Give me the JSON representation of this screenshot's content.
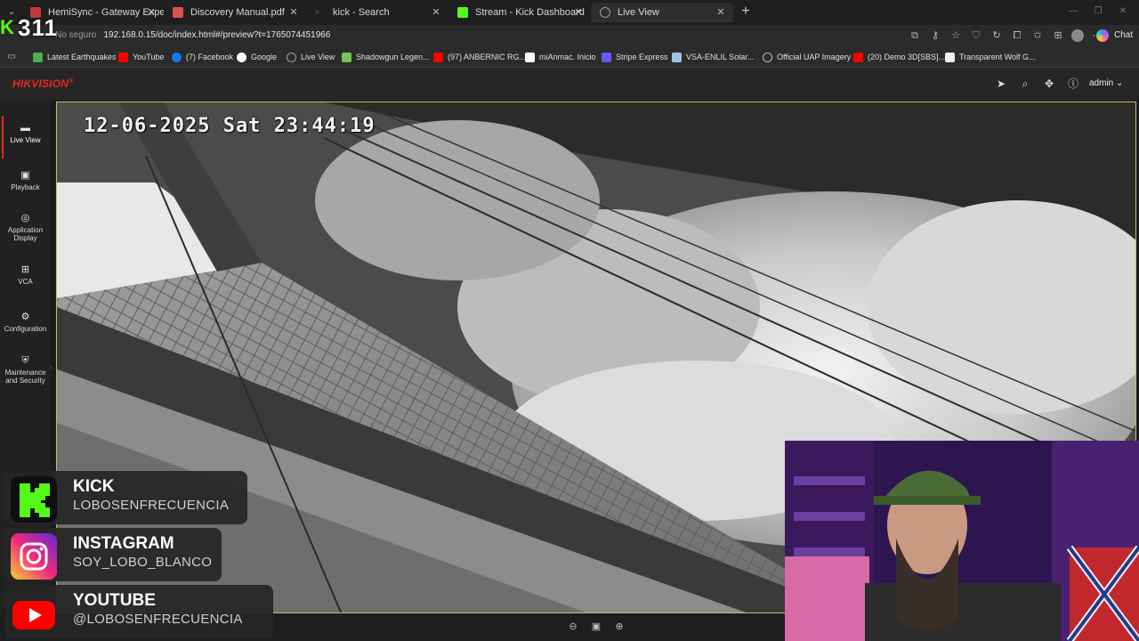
{
  "browser": {
    "tabs": [
      {
        "title": "HemiSync - Gateway Experience -",
        "favicon_color": "#c23b3b",
        "active": false
      },
      {
        "title": "Discovery Manual.pdf",
        "favicon_color": "#d9534f",
        "active": false
      },
      {
        "title": "kick - Search",
        "favicon_color": "#3c7be0",
        "active": false
      },
      {
        "title": "Stream - Kick Dashboard",
        "favicon_color": "#53fc18",
        "active": false
      },
      {
        "title": "Live View",
        "favicon_color": "#9aa0a6",
        "active": true
      }
    ],
    "url_prefix": "No seguro",
    "url": "192.168.0.15/doc/index.html#/preview?t=1765074451966",
    "chat_label": "Chat",
    "bookmarks": [
      {
        "label": "Latest Earthquakes",
        "icon_color": "#4caf50"
      },
      {
        "label": "YouTube",
        "icon_color": "#ff0000"
      },
      {
        "label": "(7) Facebook",
        "icon_color": "#1877f2"
      },
      {
        "label": "Google",
        "icon_color": "#ffffff"
      },
      {
        "label": "Live View",
        "icon_color": "#9aa0a6"
      },
      {
        "label": "Shadowgun Legen...",
        "icon_color": "#78c257"
      },
      {
        "label": "(97) ANBERNIC RG...",
        "icon_color": "#ff0000"
      },
      {
        "label": "miAnmac. Inicio",
        "icon_color": "#ffffff"
      },
      {
        "label": "Stripe Express",
        "icon_color": "#635bff"
      },
      {
        "label": "VSA-ENLIL Solar...",
        "icon_color": "#9bc4e8"
      },
      {
        "label": "Official UAP Imagery",
        "icon_color": "#c0c0c0"
      },
      {
        "label": "(20) Demo 3D[SBS]...",
        "icon_color": "#ff0000"
      },
      {
        "label": "Transparent Wolf G...",
        "icon_color": "#f0f0f0"
      }
    ]
  },
  "app": {
    "brand": "HIKVISION",
    "brand_mark": "®",
    "user": "admin",
    "nav": [
      {
        "label": "Live View",
        "icon": "monitor-icon",
        "active": true
      },
      {
        "label": "Playback",
        "icon": "playback-icon",
        "active": false
      },
      {
        "label": "Application Display",
        "icon": "application-icon",
        "active": false
      },
      {
        "label": "VCA",
        "icon": "vca-icon",
        "active": false
      },
      {
        "label": "Configuration",
        "icon": "gear-icon",
        "active": false
      },
      {
        "label": "Maintenance and Security",
        "icon": "maintenance-icon",
        "active": false
      }
    ],
    "osd_timestamp": "12-06-2025 Sat 23:44:19"
  },
  "overlay": {
    "viewer_count": "311",
    "socials": [
      {
        "title": "KICK",
        "handle": "LOBOSENFRECUENCIA",
        "color": "#53fc18",
        "icon": "kick-icon"
      },
      {
        "title": "INSTAGRAM",
        "handle": "SOY_LOBO_BLANCO",
        "color": "#e1306c",
        "icon": "instagram-icon"
      },
      {
        "title": "YOUTUBE",
        "handle": "@LOBOSENFRECUENCIA",
        "color": "#ff0000",
        "icon": "youtube-icon"
      }
    ]
  }
}
